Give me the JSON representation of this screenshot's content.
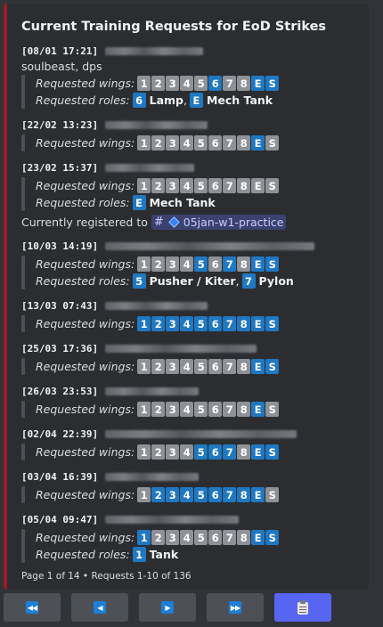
{
  "title": "Current Training Requests for EoD Strikes",
  "labels": {
    "requested_wings": "Requested wings:",
    "requested_roles": "Requested roles:",
    "registered": "Currently registered to"
  },
  "wing_labels": [
    "1",
    "2",
    "3",
    "4",
    "5",
    "6",
    "7",
    "8",
    "E",
    "S"
  ],
  "colors": {
    "accent_bar": "#9d1b22",
    "chip_selected": "#1f78c1",
    "chip_unselected": "#8e9297",
    "primary_button": "#5865f2"
  },
  "requests": [
    {
      "timestamp": "[08/01 17:21]",
      "note": "soulbeast, dps",
      "wings": [
        false,
        false,
        false,
        false,
        false,
        true,
        false,
        false,
        true,
        true
      ],
      "roles": [
        {
          "num": "6",
          "name": "Lamp"
        },
        {
          "num": "E",
          "name": "Mech Tank"
        }
      ]
    },
    {
      "timestamp": "[22/02 13:23]",
      "wings": [
        false,
        false,
        false,
        false,
        false,
        false,
        false,
        false,
        true,
        false
      ]
    },
    {
      "timestamp": "[23/02 15:37]",
      "wings": [
        false,
        false,
        false,
        false,
        false,
        false,
        false,
        false,
        false,
        false
      ],
      "roles": [
        {
          "num": "E",
          "name": "Mech Tank"
        }
      ],
      "registered_channel": "05jan-w1-practice"
    },
    {
      "timestamp": "[10/03 14:19]",
      "wings": [
        false,
        false,
        false,
        false,
        true,
        false,
        true,
        false,
        true,
        true
      ],
      "roles": [
        {
          "num": "5",
          "name": "Pusher / Kiter"
        },
        {
          "num": "7",
          "name": "Pylon"
        }
      ]
    },
    {
      "timestamp": "[13/03 07:43]",
      "wings": [
        true,
        true,
        true,
        true,
        true,
        true,
        true,
        true,
        true,
        true
      ]
    },
    {
      "timestamp": "[25/03 17:36]",
      "wings": [
        false,
        false,
        false,
        false,
        false,
        false,
        false,
        false,
        true,
        true
      ]
    },
    {
      "timestamp": "[26/03 23:53]",
      "wings": [
        false,
        false,
        false,
        false,
        false,
        false,
        false,
        false,
        true,
        false
      ]
    },
    {
      "timestamp": "[02/04 22:39]",
      "wings": [
        false,
        false,
        false,
        false,
        true,
        true,
        true,
        false,
        true,
        true
      ]
    },
    {
      "timestamp": "[03/04 16:39]",
      "wings": [
        false,
        true,
        true,
        true,
        true,
        true,
        true,
        true,
        true,
        false
      ]
    },
    {
      "timestamp": "[05/04 09:47]",
      "wings": [
        true,
        false,
        false,
        false,
        false,
        false,
        false,
        false,
        true,
        true
      ],
      "roles": [
        {
          "num": "1",
          "name": "Tank"
        }
      ]
    }
  ],
  "footer": "Page 1 of 14 • Requests 1-10 of 136",
  "buttons": [
    {
      "name": "first-page-button",
      "icon": "double-left-arrow-icon",
      "glyph": "◀◀"
    },
    {
      "name": "previous-page-button",
      "icon": "left-arrow-icon",
      "glyph": "◀"
    },
    {
      "name": "next-page-button",
      "icon": "right-arrow-icon",
      "glyph": "▶"
    },
    {
      "name": "last-page-button",
      "icon": "double-right-arrow-icon",
      "glyph": "▶▶"
    },
    {
      "name": "clipboard-button",
      "icon": "clipboard-icon",
      "glyph": ""
    }
  ]
}
